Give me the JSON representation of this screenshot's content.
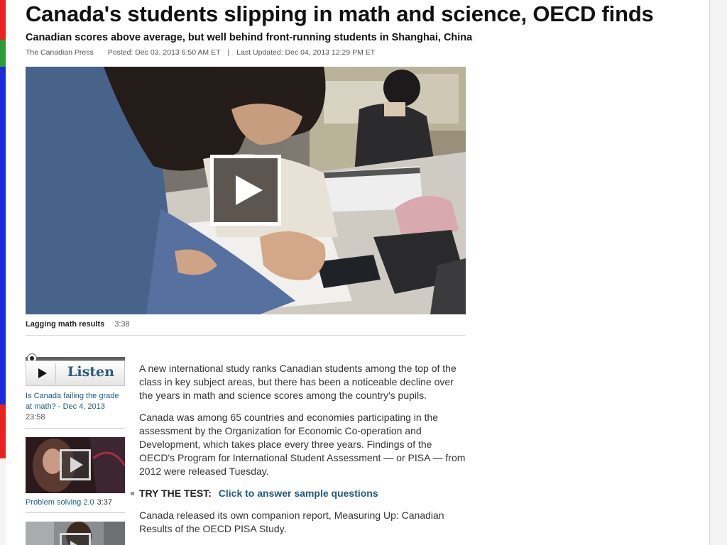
{
  "article": {
    "headline": "Canada's students slipping in math and science, OECD finds",
    "subhead": "Canadian scores above average, but well behind front-running students in Shanghai, China",
    "byline": {
      "source": "The Canadian Press",
      "posted": "Posted: Dec 03, 2013 6:50 AM ET",
      "separator": "|",
      "updated": "Last Updated: Dec 04, 2013 12:29 PM ET"
    },
    "paragraphs": [
      "A new international study ranks Canadian students among the top of the class in key subject areas, but there has been a noticeable decline over the years in math and science scores among the country's pupils.",
      "Canada was among 65 countries and economies participating in the assessment by the Organization for Economic Co-operation and Development, which takes place every three years. Findings of the OECD's Program for International Student Assessment — or PISA — from 2012 were released Tuesday.",
      "Canada released its own companion report, Measuring Up: Canadian Results of the OECD PISA Study."
    ],
    "try_test": {
      "label": "TRY THE TEST:",
      "link": "Click to answer sample questions"
    }
  },
  "video": {
    "title": "Lagging math results",
    "duration": "3:38",
    "play_icon": "play-icon"
  },
  "sidebar": {
    "listen": {
      "label": "Listen",
      "link": "Is Canada failing the grade at math? - Dec 4, 2013",
      "duration": "23:58"
    },
    "related": [
      {
        "title": "Problem solving 2.0",
        "duration": "3:37"
      }
    ]
  },
  "colors": {
    "link": "#1f5a84",
    "listen_text": "#2a5b7f",
    "edge_red": "#e8231f",
    "edge_green": "#2e9a3a",
    "edge_blue": "#1a2bd9"
  }
}
